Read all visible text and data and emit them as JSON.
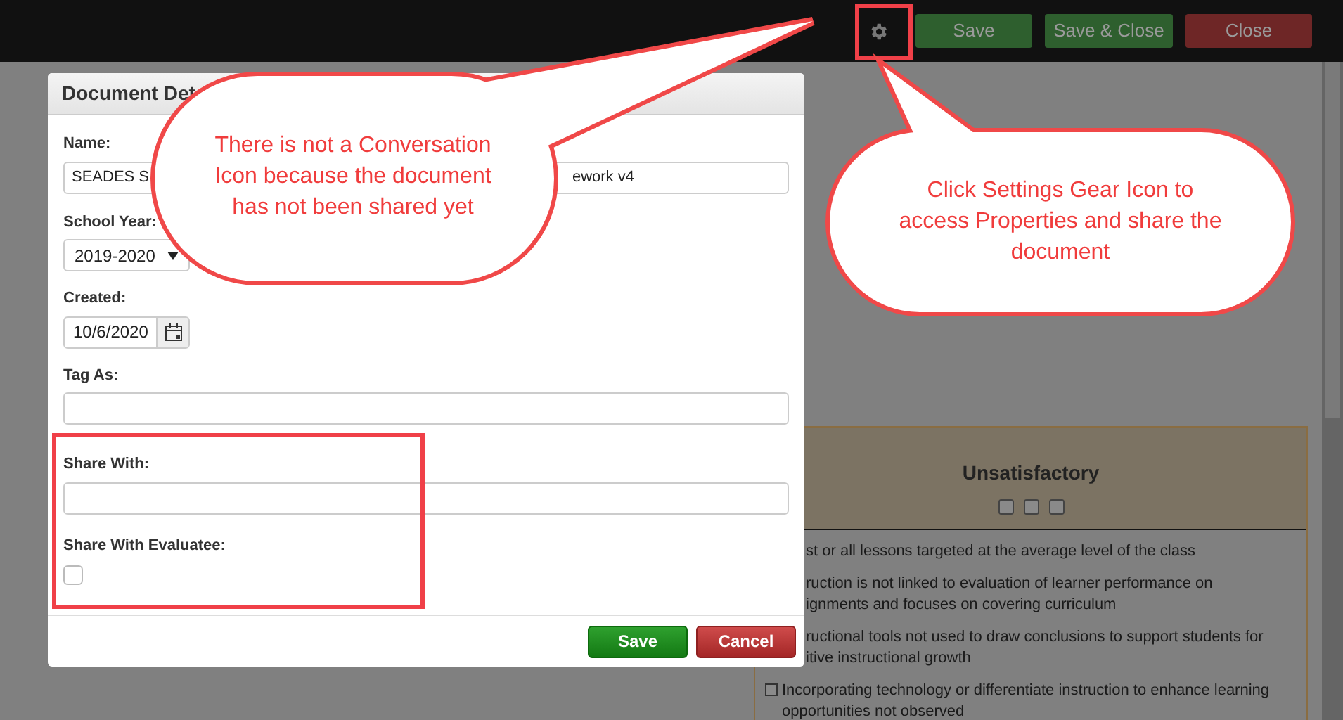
{
  "toolbar": {
    "buttons": [
      {
        "label": "Save",
        "kind": "save"
      },
      {
        "label": "Save & Close",
        "kind": "save"
      },
      {
        "label": "Close",
        "kind": "close"
      }
    ]
  },
  "dialog": {
    "title": "Document Det",
    "name": {
      "label": "Name:",
      "value_start": "SEADES S",
      "value_end": "ework v4"
    },
    "school_year": {
      "label": "School Year:",
      "value": "2019-2020"
    },
    "created": {
      "label": "Created:",
      "value": "10/6/2020"
    },
    "tag_as": {
      "label": "Tag As:"
    },
    "share_with": {
      "label": "Share With:"
    },
    "share_with_evaluatee": {
      "label": "Share With Evaluatee:",
      "checked": false
    },
    "buttons": [
      {
        "label": "Save",
        "kind": "save"
      },
      {
        "label": "Cancel",
        "kind": "cancel"
      }
    ]
  },
  "rubric": {
    "heading": "Unsatisfactory",
    "rating_boxes": [
      {
        "checked": false
      },
      {
        "checked": false
      },
      {
        "checked": false
      }
    ],
    "items": [
      {
        "kind": "text",
        "lines": [
          "st or all lessons targeted at the average level of the class"
        ]
      },
      {
        "kind": "text",
        "lines": [
          "ruction is not linked to evaluation of learner performance on",
          "ignments and focuses on covering curriculum"
        ]
      },
      {
        "kind": "text",
        "lines": [
          "ructional tools not used to draw conclusions to support students for",
          "itive instructional growth"
        ]
      },
      {
        "kind": "checkbox",
        "checked": false,
        "lines": [
          "Incorporating technology or differentiate instruction to enhance learning",
          "opportunities not observed"
        ]
      }
    ]
  },
  "callouts": [
    {
      "text": "There is not a Conversation Icon because the document has not been shared yet"
    },
    {
      "text": "Click Settings Gear Icon to access Properties and share the document"
    }
  ]
}
